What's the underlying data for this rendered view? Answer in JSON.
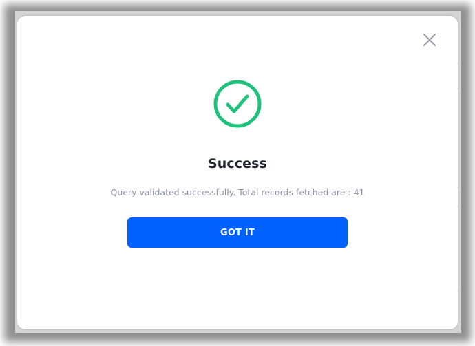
{
  "dialog": {
    "title": "Success",
    "message": "Query validated successfully. Total records fetched are : 41",
    "primary_button_label": "GOT IT",
    "close_icon": "close-icon",
    "status_icon": "check-circle-icon"
  },
  "colors": {
    "success": "#1ec27a",
    "primary": "#0061ff",
    "title_text": "#1f2430",
    "message_text": "#8a93a2",
    "close_icon": "#9aa3ad"
  }
}
